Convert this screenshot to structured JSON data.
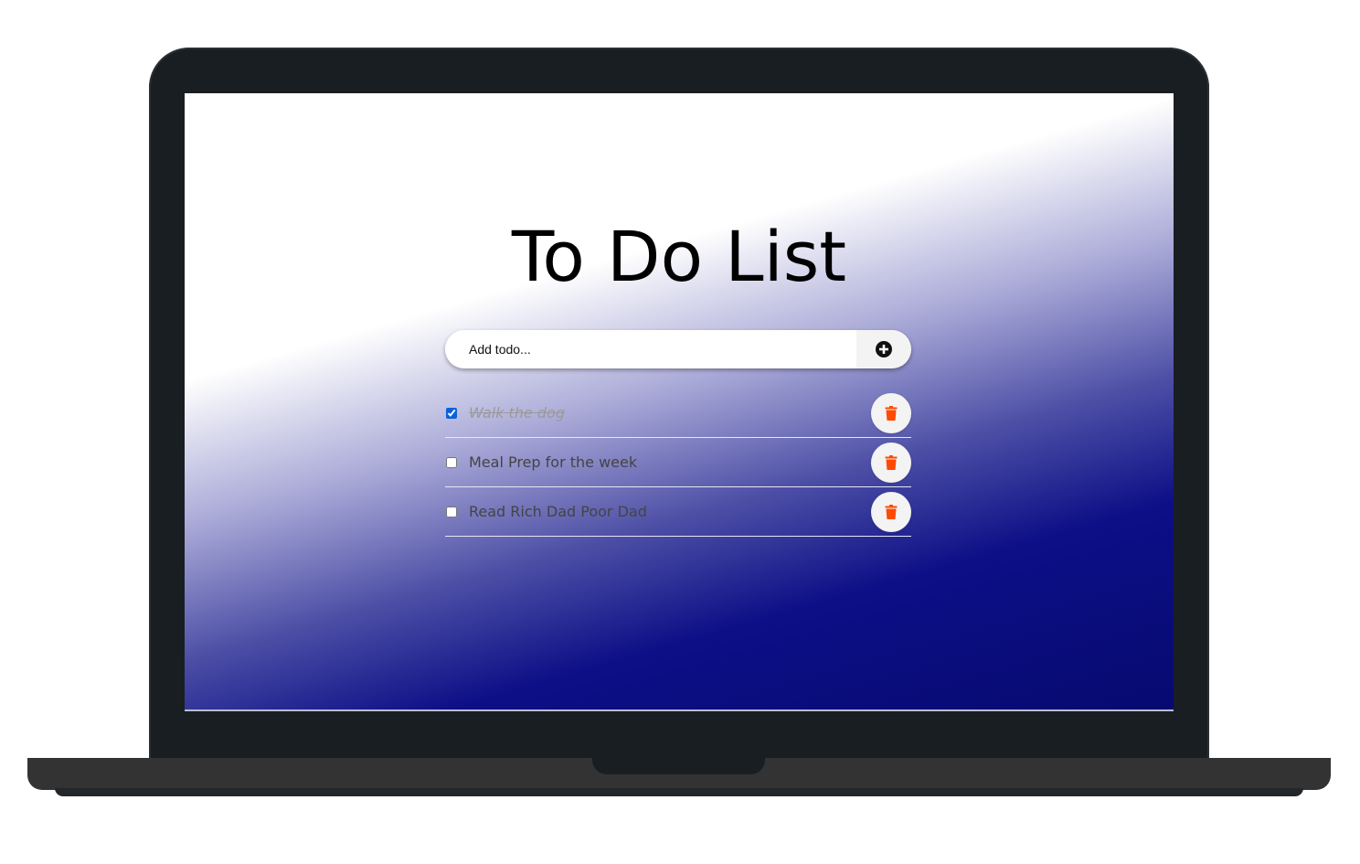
{
  "app": {
    "title": "To Do List"
  },
  "add_form": {
    "placeholder": "Add todo...",
    "add_icon": "plus-circle-icon"
  },
  "todos": [
    {
      "label": "Walk the dog",
      "completed": true,
      "delete_icon": "trash-icon"
    },
    {
      "label": "Meal Prep for the week",
      "completed": false,
      "delete_icon": "trash-icon"
    },
    {
      "label": "Read Rich Dad Poor Dad",
      "completed": false,
      "delete_icon": "trash-icon"
    }
  ],
  "colors": {
    "accent_delete": "#ff4a00",
    "gradient_dark": "#0c0f86",
    "checkbox": "#0a62d8"
  }
}
